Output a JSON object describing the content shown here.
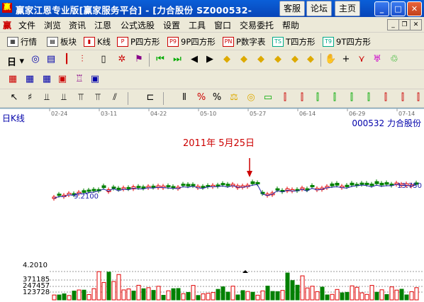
{
  "window": {
    "title": "赢家江恩专业版[赢家服务平台] - [力合股份  SZ000532-",
    "buttons": [
      "客服",
      "论坛",
      "主页"
    ]
  },
  "menu": {
    "logo": "赢",
    "items": [
      "文件",
      "浏览",
      "资讯",
      "江恩",
      "公式选股",
      "设置",
      "工具",
      "窗口",
      "交易委托",
      "帮助"
    ]
  },
  "toolbar1": {
    "items": [
      {
        "icon": "table-icon",
        "label": "行情"
      },
      {
        "icon": "block-icon",
        "label": "板块"
      },
      {
        "icon": "kline-icon",
        "label": "K线"
      },
      {
        "icon": "P",
        "label": "P四方形"
      },
      {
        "icon": "P9",
        "label": "9P四方形"
      },
      {
        "icon": "PN",
        "label": "P数字表"
      },
      {
        "icon": "TS",
        "label": "T四方形"
      },
      {
        "icon": "T9",
        "label": "9T四方形"
      }
    ]
  },
  "toolbar2": {
    "period": "日"
  },
  "chart": {
    "period_label": "日K线",
    "stock_label": "000532  力合股份",
    "annotation": "2011年 5月25日",
    "price_low_label": "9.2100",
    "price_high_label": "13.750",
    "dates": [
      "02-24",
      "03-11",
      "04-22",
      "05-10",
      "05-27",
      "06-14",
      "06-29",
      "07-14"
    ],
    "volume_labels": [
      "4.2010",
      "371185",
      "247457",
      "123728"
    ],
    "colors": {
      "up": "#e00000",
      "down": "#008000",
      "annot": "#c00000",
      "label": "#0000aa"
    }
  },
  "chart_data": {
    "type": "bar",
    "title": "",
    "categories": [
      "02-24",
      "03-11",
      "04-22",
      "05-10",
      "05-27",
      "06-14",
      "06-29",
      "07-14"
    ],
    "series": [
      {
        "name": "",
        "values": [
          9.21,
          9.8,
          9.9,
          10.3,
          10.6,
          10.1,
          10.9,
          13.75
        ]
      }
    ],
    "ylim": [
      9,
      14
    ]
  }
}
